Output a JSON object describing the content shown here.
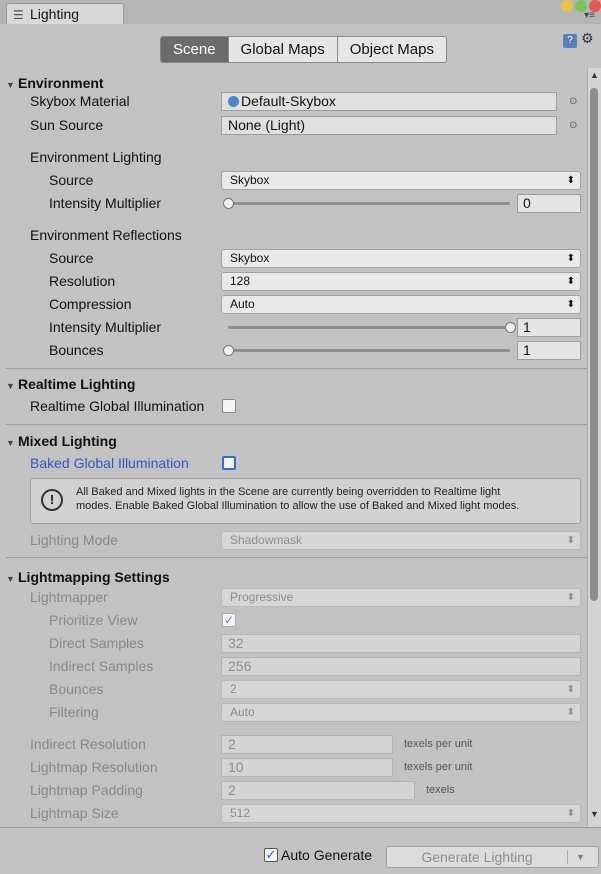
{
  "window": {
    "tab_title": "Lighting",
    "tab_icon": "sliders-icon"
  },
  "toolbar": {
    "tabs": [
      {
        "label": "Scene",
        "active": true
      },
      {
        "label": "Global Maps",
        "active": false
      },
      {
        "label": "Object Maps",
        "active": false
      }
    ],
    "help_icon_glyph": "?",
    "settings_icon_glyph": "⚙"
  },
  "environment": {
    "header": "Environment",
    "skybox_material": {
      "label": "Skybox Material",
      "value": "Default-Skybox"
    },
    "sun_source": {
      "label": "Sun Source",
      "value": "None (Light)"
    },
    "env_lighting": {
      "header": "Environment Lighting",
      "source": {
        "label": "Source",
        "value": "Skybox"
      },
      "intensity": {
        "label": "Intensity Multiplier",
        "value": "0",
        "level": 0
      }
    },
    "env_reflections": {
      "header": "Environment Reflections",
      "source": {
        "label": "Source",
        "value": "Skybox"
      },
      "resolution": {
        "label": "Resolution",
        "value": "128"
      },
      "compression": {
        "label": "Compression",
        "value": "Auto"
      },
      "intensity": {
        "label": "Intensity Multiplier",
        "value": "1",
        "level": 1
      },
      "bounces": {
        "label": "Bounces",
        "value": "1",
        "level": 0
      }
    }
  },
  "realtime": {
    "header": "Realtime Lighting",
    "gi": {
      "label": "Realtime Global Illumination",
      "checked": false
    }
  },
  "mixed": {
    "header": "Mixed Lighting",
    "baked_gi": {
      "label": "Baked Global Illumination",
      "checked": false
    },
    "info_line1": "All Baked and Mixed lights in the Scene are currently being overridden to Realtime light",
    "info_line2": "modes. Enable Baked Global Illumination to allow the use of Baked and Mixed light modes.",
    "lighting_mode": {
      "label": "Lighting Mode",
      "value": "Shadowmask"
    }
  },
  "lightmapping": {
    "header": "Lightmapping Settings",
    "lightmapper": {
      "label": "Lightmapper",
      "value": "Progressive"
    },
    "prioritize_view": {
      "label": "Prioritize View",
      "checked": true
    },
    "direct_samples": {
      "label": "Direct Samples",
      "value": "32"
    },
    "indirect_samples": {
      "label": "Indirect Samples",
      "value": "256"
    },
    "bounces": {
      "label": "Bounces",
      "value": "2"
    },
    "filtering": {
      "label": "Filtering",
      "value": "Auto"
    },
    "indirect_resolution": {
      "label": "Indirect Resolution",
      "value": "2",
      "unit": "texels per unit"
    },
    "lightmap_resolution": {
      "label": "Lightmap Resolution",
      "value": "10",
      "unit": "texels per unit"
    },
    "lightmap_padding": {
      "label": "Lightmap Padding",
      "value": "2",
      "unit": "texels"
    },
    "lightmap_size": {
      "label": "Lightmap Size",
      "value": "512"
    }
  },
  "footer": {
    "auto_generate": {
      "label": "Auto Generate",
      "checked": true
    },
    "generate_button": "Generate Lighting"
  },
  "colors": {
    "panel_bg": "#c2c2c2",
    "active_tab": "#6b6b6b",
    "link_blue": "#2b57c7"
  }
}
